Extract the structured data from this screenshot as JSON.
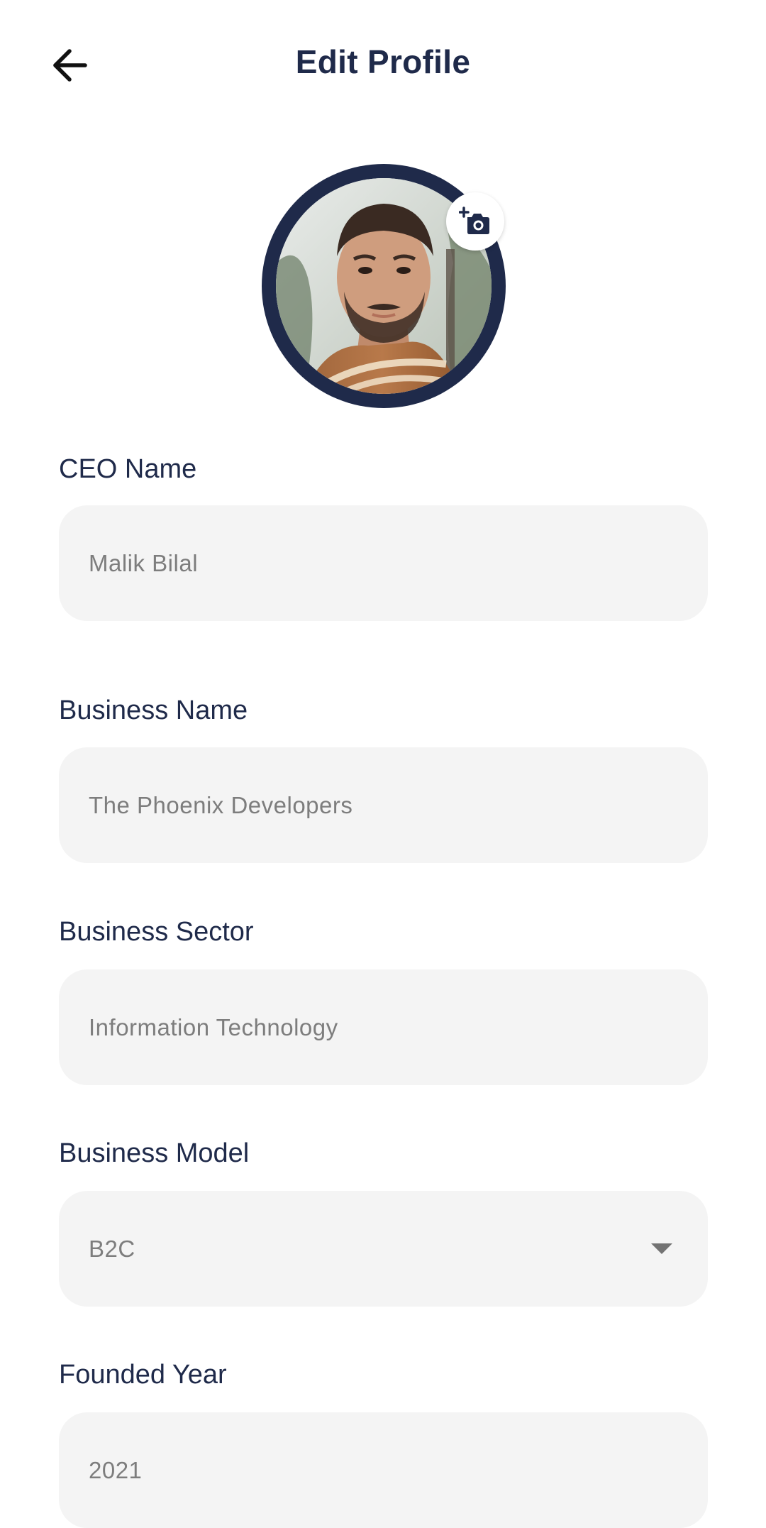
{
  "header": {
    "title": "Edit Profile"
  },
  "icons": {
    "back": "arrow-left-icon",
    "camera": "add-photo-camera-icon",
    "dropdown": "caret-down-icon"
  },
  "colors": {
    "primary": "#1f2a4a",
    "field_bg": "#f4f4f4",
    "value_text": "#7d7d7d"
  },
  "form": {
    "ceo_name": {
      "label": "CEO Name",
      "value": "Malik Bilal"
    },
    "business_name": {
      "label": "Business Name",
      "value": "The Phoenix Developers"
    },
    "business_sector": {
      "label": "Business Sector",
      "value": "Information Technology"
    },
    "business_model": {
      "label": "Business Model",
      "value": "B2C"
    },
    "founded_year": {
      "label": "Founded Year",
      "value": "2021"
    }
  }
}
